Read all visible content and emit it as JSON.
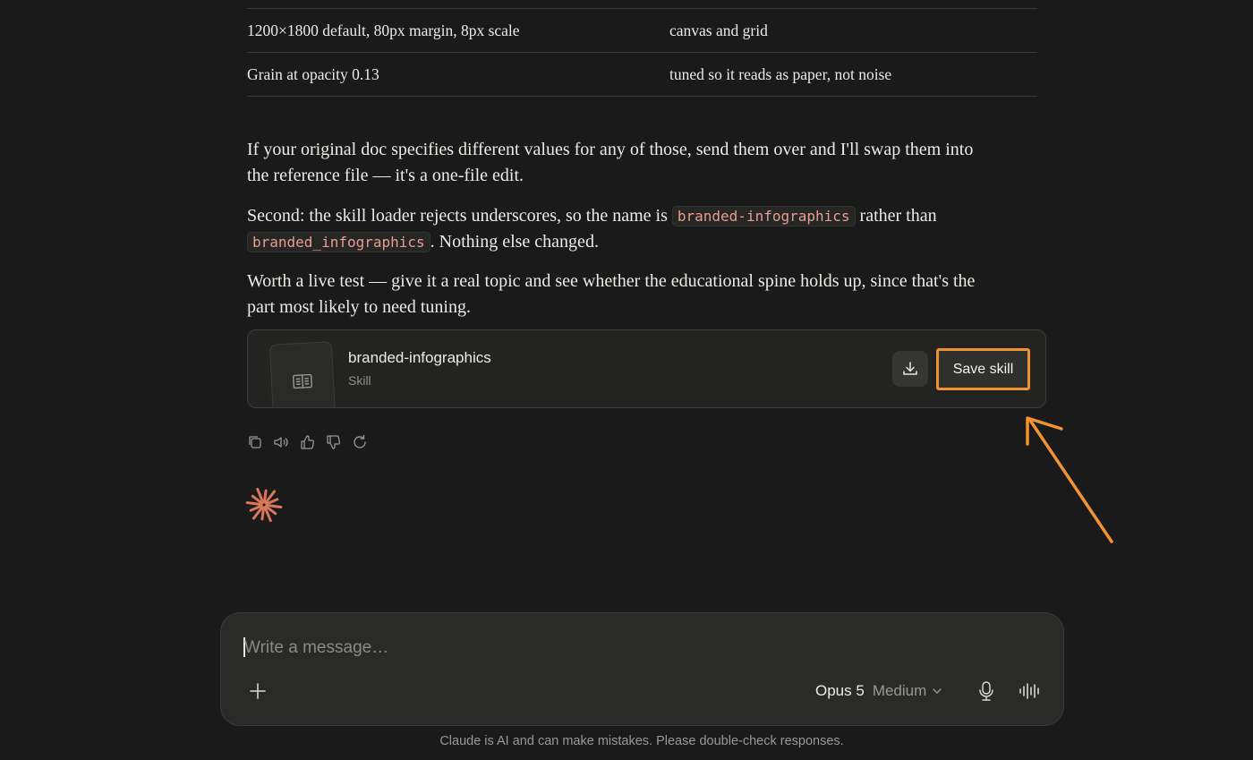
{
  "table": {
    "rows": [
      {
        "left": "1200×1800 default, 80px margin, 8px scale",
        "right": "canvas and grid"
      },
      {
        "left": "Grain at opacity 0.13",
        "right": "tuned so it reads as paper, not noise"
      }
    ]
  },
  "message": {
    "p1": "If your original doc specifies different values for any of those, send them over and I'll swap them into the reference file — it's a one-file edit.",
    "p2_a": "Second: the skill loader rejects underscores, so the name is ",
    "p2_code1": "branded-infographics",
    "p2_b": " rather than ",
    "p2_code2": "branded_infographics",
    "p2_c": ". Nothing else changed.",
    "p3": "Worth a live test — give it a real topic and see whether the educational spine holds up, since that's the part most likely to need tuning."
  },
  "artifact": {
    "title": "branded-infographics",
    "type": "Skill",
    "icon": "book-open-icon",
    "download_icon": "download-icon",
    "save_label": "Save skill"
  },
  "actions": [
    "copy-icon",
    "speaker-icon",
    "thumbs-up-icon",
    "thumbs-down-icon",
    "retry-icon"
  ],
  "annotation": {
    "color": "#f0922f"
  },
  "composer": {
    "placeholder": "Write a message…",
    "model": "Opus 5",
    "level": "Medium"
  },
  "footer": {
    "disclaimer": "Claude is AI and can make mistakes. Please double-check responses."
  },
  "colors": {
    "background": "#1a1a1a",
    "accent": "#d97757",
    "code_text": "#e99d8f"
  }
}
